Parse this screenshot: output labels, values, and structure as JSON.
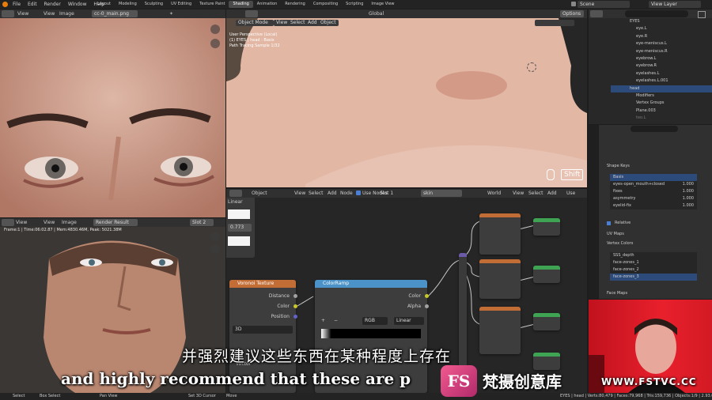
{
  "topbar": {
    "menus": [
      "File",
      "Edit",
      "Render",
      "Window",
      "Help"
    ],
    "workspaces": [
      "Layout",
      "Modeling",
      "Sculpting",
      "UV Editing",
      "Texture Paint",
      "Shading",
      "Animation",
      "Rendering",
      "Compositing",
      "Scripting",
      "Image View"
    ],
    "active_workspace": "Shading",
    "scene": "Scene",
    "view_layer": "View Layer"
  },
  "image_editor": {
    "view": "View",
    "menus": [
      "View",
      "Image"
    ],
    "image_name": "cc-0_main.png"
  },
  "render_editor": {
    "menus": [
      "View",
      "View",
      "Image"
    ],
    "image_name": "Render Result",
    "slot": "Slot 2",
    "frame_info": "Frame:1 | Time:06:02.87 | Mem:4830.46M, Peak: 5021.38M"
  },
  "viewport": {
    "mode": "Object Mode",
    "menus": [
      "View",
      "Select",
      "Add",
      "Object"
    ],
    "transform": "Global",
    "options": "Options",
    "overlay_lines": [
      "User Perspective (Local)",
      "(1) EYES | head : Basis",
      "Path Tracing Sample 1/32"
    ],
    "shift_key": "Shift"
  },
  "node_editor": {
    "type": "Object",
    "menus": [
      "View",
      "Select",
      "Add",
      "Node"
    ],
    "use_nodes": "Use Nodes",
    "slot": "Slot 1",
    "material": "skin",
    "world": "World",
    "right_menus": [
      "View",
      "Select",
      "Add",
      "Use"
    ]
  },
  "side_panel": {
    "interp": "Linear",
    "value": "0.773"
  },
  "voronoi_node": {
    "title": "Voronoi Texture",
    "outputs": [
      "Distance",
      "Color",
      "Position"
    ],
    "dimension": "3D",
    "input": "Vector"
  },
  "colorramp_node": {
    "title": "ColorRamp",
    "outputs": [
      "Color",
      "Alpha"
    ],
    "color_mode": "RGB",
    "interpolation": "Linear"
  },
  "outliner": {
    "rows": [
      {
        "label": "EYES",
        "sel": false
      },
      {
        "label": "eye.L",
        "sel": false
      },
      {
        "label": "eye.R",
        "sel": false
      },
      {
        "label": "eye-meniscus.L",
        "sel": false
      },
      {
        "label": "eye-meniscus.R",
        "sel": false
      },
      {
        "label": "eyebrow.L",
        "sel": false
      },
      {
        "label": "eyebrow.R",
        "sel": false
      },
      {
        "label": "eyelashes.L",
        "sel": false
      },
      {
        "label": "eyelashes.L.001",
        "sel": false
      },
      {
        "label": "head",
        "sel": true
      },
      {
        "label": "Modifiers",
        "sel": false
      },
      {
        "label": "Vertex Groups",
        "sel": false
      },
      {
        "label": "Plane.003",
        "sel": false
      },
      {
        "label": "teo.L",
        "sel": false
      }
    ]
  },
  "properties": {
    "shape_keys_title": "Shape Keys",
    "shape_keys": [
      {
        "name": "Basis",
        "value": ""
      },
      {
        "name": "eyes-open_mouth+closed",
        "value": "1.000"
      },
      {
        "name": "fixes",
        "value": "1.000"
      },
      {
        "name": "asymmetry",
        "value": "1.000"
      },
      {
        "name": "eyelid-fix",
        "value": "1.000"
      }
    ],
    "relative": "Relative",
    "uv_maps": "UV Maps",
    "vertex_colors": "Vertex Colors",
    "vertex_color_items": [
      "SSS_depth",
      "face-zones_1",
      "face-zones_2",
      "face-zones_3"
    ],
    "face_maps": "Face Maps"
  },
  "statusbar": {
    "left": [
      "Select",
      "Box Select",
      "Pan View",
      "Set 3D Cursor",
      "Move"
    ],
    "right": "EYES | head | Verts:80,479 | Faces:79,968 | Tris:159,736 | Objects:1/9 | 2.93.0"
  },
  "overlay": {
    "subtitle_cn": "并强烈建议这些东西在某种程度上存在",
    "subtitle_en": "and highly recommend that these are p",
    "logo_text": "FS",
    "brand_cn": "梵摄创意库",
    "watermark": "WWW.FSTVC.CC"
  }
}
